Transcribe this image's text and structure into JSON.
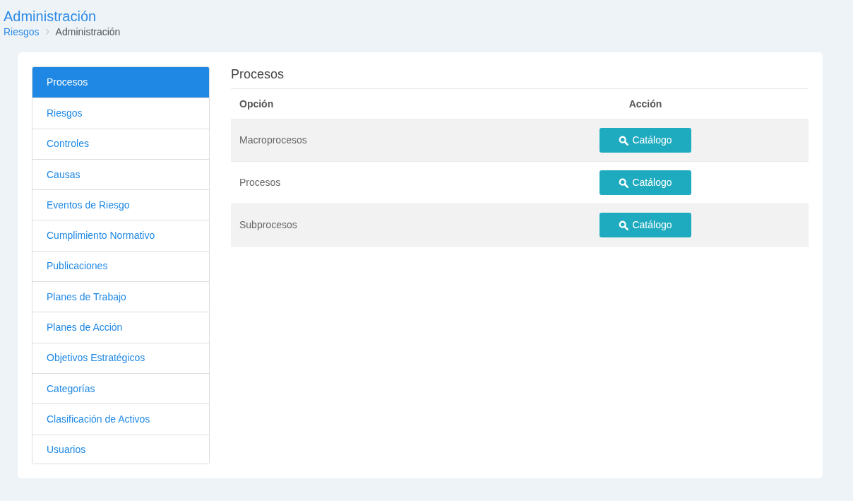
{
  "page": {
    "title": "Administración",
    "breadcrumb": [
      {
        "label": "Riesgos",
        "kind": "link"
      },
      {
        "label": "Administración",
        "kind": "current"
      }
    ]
  },
  "sidebar": {
    "items": [
      {
        "label": "Procesos",
        "selected": true
      },
      {
        "label": "Riesgos",
        "selected": false
      },
      {
        "label": "Controles",
        "selected": false
      },
      {
        "label": "Causas",
        "selected": false
      },
      {
        "label": "Eventos de Riesgo",
        "selected": false
      },
      {
        "label": "Cumplimiento Normativo",
        "selected": false
      },
      {
        "label": "Publicaciones",
        "selected": false
      },
      {
        "label": "Planes de Trabajo",
        "selected": false
      },
      {
        "label": "Planes de Acción",
        "selected": false
      },
      {
        "label": "Objetivos Estratégicos",
        "selected": false
      },
      {
        "label": "Categorías",
        "selected": false
      },
      {
        "label": "Clasificación de Activos",
        "selected": false
      },
      {
        "label": "Usuarios",
        "selected": false
      }
    ]
  },
  "panel": {
    "title": "Procesos",
    "table": {
      "columns": [
        "Opción",
        "Acción"
      ],
      "rows": [
        {
          "option": "Macroprocesos",
          "action": "Catálogo"
        },
        {
          "option": "Procesos",
          "action": "Catálogo"
        },
        {
          "option": "Subprocesos",
          "action": "Catálogo"
        }
      ]
    }
  }
}
